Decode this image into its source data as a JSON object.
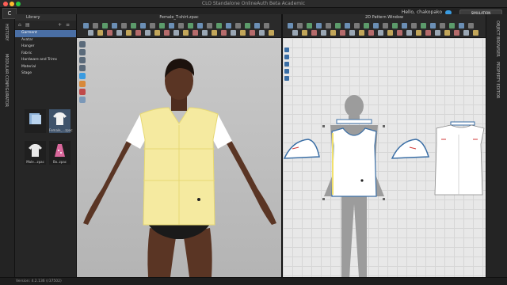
{
  "window": {
    "title": "CLO Standalone OnlineAuth Beta Academic"
  },
  "menubar": {
    "hello": "Hello, chakopako",
    "simulation": "SIMULATION"
  },
  "left_tabs": {
    "history": "HISTORY",
    "modular": "MODULAR CONFIGURATOR"
  },
  "library": {
    "title": "Library",
    "items": [
      "Garment",
      "Avatar",
      "Hanger",
      "Fabric",
      "Hardware and Trims",
      "Material",
      "Stage"
    ],
    "selected_index": 0,
    "thumbnails": [
      "",
      "Female_...zpac",
      "Male...zpac",
      "Bo..zpac"
    ]
  },
  "viewer3d": {
    "title": "Female_T-shirt.zpac"
  },
  "pattern": {
    "title": "2D Pattern Window"
  },
  "right_tabs": {
    "object_browser": "OBJECT BROWSER",
    "property_editor": "PROPERTY EDITOR"
  },
  "status": {
    "version": "Version: 4.2.136 (r37502)"
  },
  "colors": {
    "accent": "#4a6fa5",
    "shirt": "#f5eaa0",
    "skin": "#5a3524",
    "sleeve": "#ffffff",
    "pattern_outline": "#3a6ea5"
  }
}
